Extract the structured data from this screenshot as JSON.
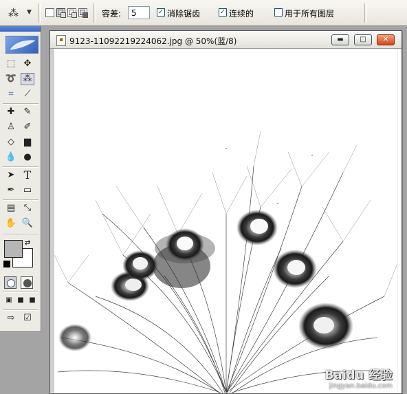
{
  "options_bar": {
    "current_tool_icon": "magic-wand-icon",
    "tolerance_label": "容差:",
    "tolerance_value": "5",
    "anti_alias_label": "消除锯齿",
    "anti_alias_checked": true,
    "contiguous_label": "连续的",
    "contiguous_checked": true,
    "all_layers_label": "用于所有图层",
    "all_layers_checked": false
  },
  "toolbox": {
    "foreground_color": "#b6b6b6",
    "background_color": "#ffffff",
    "type_tool_glyph": "T"
  },
  "document": {
    "title": "9123-11092219224062.jpg @ 50%(蓝/8)",
    "minimize_glyph": "▬",
    "maximize_glyph": "□",
    "close_glyph": "✕"
  },
  "watermark": {
    "brand": "Baidu 经验",
    "url": "jingyan.baidu.com"
  },
  "colors": {
    "titlebar_blue": "#3b67c0",
    "close_button": "#d3461c"
  }
}
